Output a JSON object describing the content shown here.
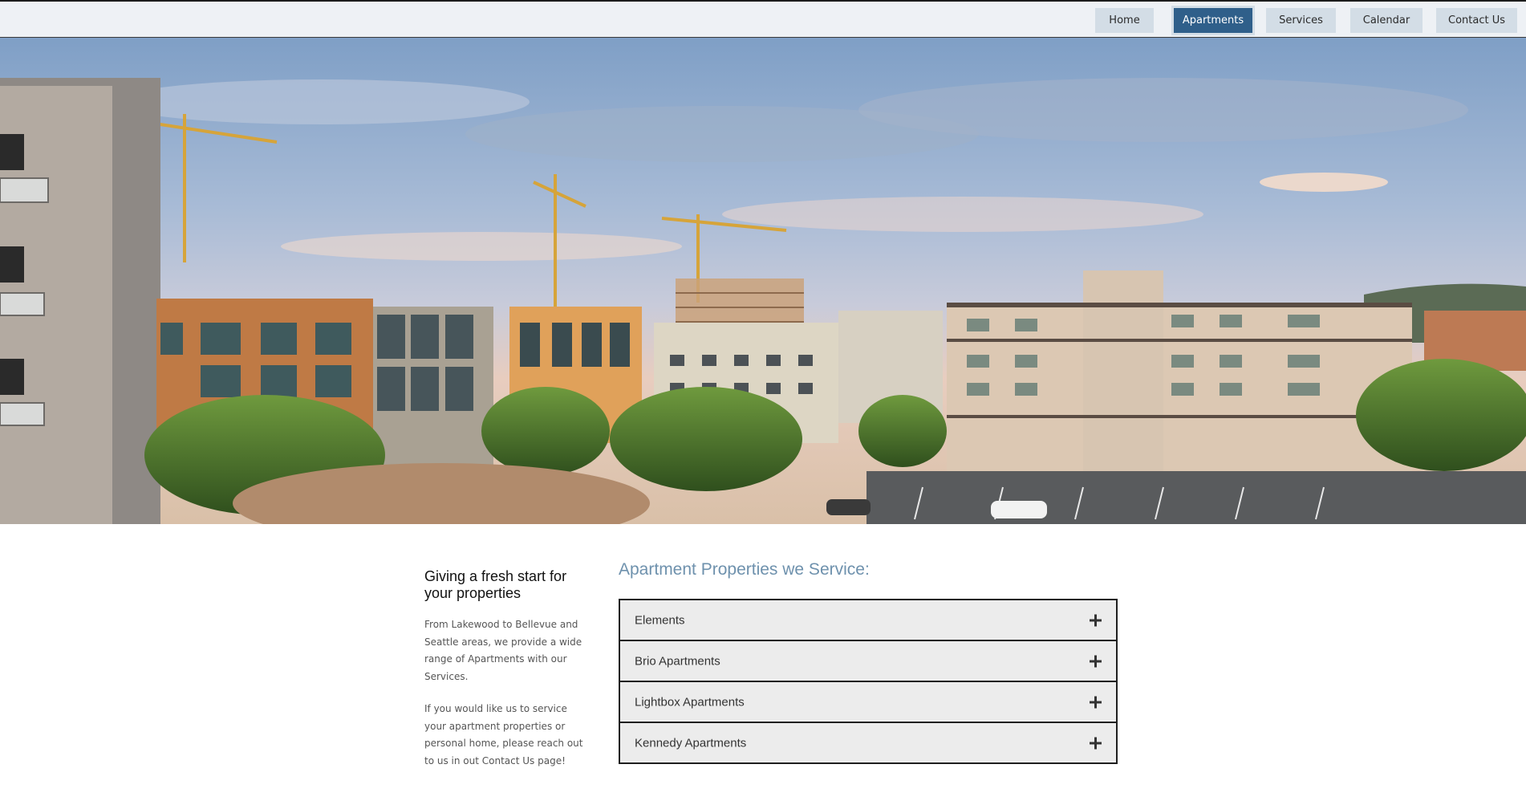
{
  "nav": {
    "items": [
      {
        "label": "Home",
        "active": false
      },
      {
        "label": "Apartments",
        "active": true
      },
      {
        "label": "Services",
        "active": false
      },
      {
        "label": "Calendar",
        "active": false
      },
      {
        "label": "Contact Us",
        "active": false
      }
    ]
  },
  "hero": {
    "icon": "apartment-cityscape-photo"
  },
  "intro": {
    "heading": "Giving a fresh start for your properties",
    "paragraph1": "From Lakewood to Bellevue and Seattle areas, we provide a wide range of Apartments with our Services.",
    "paragraph2": "If you would like us to service your apartment properties or personal home, please reach out to us in out Contact Us page!"
  },
  "properties": {
    "title": "Apartment Properties we Service:",
    "items": [
      {
        "label": "Elements",
        "icon": "plus-icon"
      },
      {
        "label": "Brio Apartments",
        "icon": "plus-icon"
      },
      {
        "label": "Lightbox Apartments",
        "icon": "plus-icon"
      },
      {
        "label": "Kennedy Apartments",
        "icon": "plus-icon"
      }
    ]
  },
  "colors": {
    "nav_bg": "#d3dde6",
    "nav_active": "#2f5f8a",
    "title_blue": "#6e91ad",
    "accordion_bg": "#ececec"
  }
}
